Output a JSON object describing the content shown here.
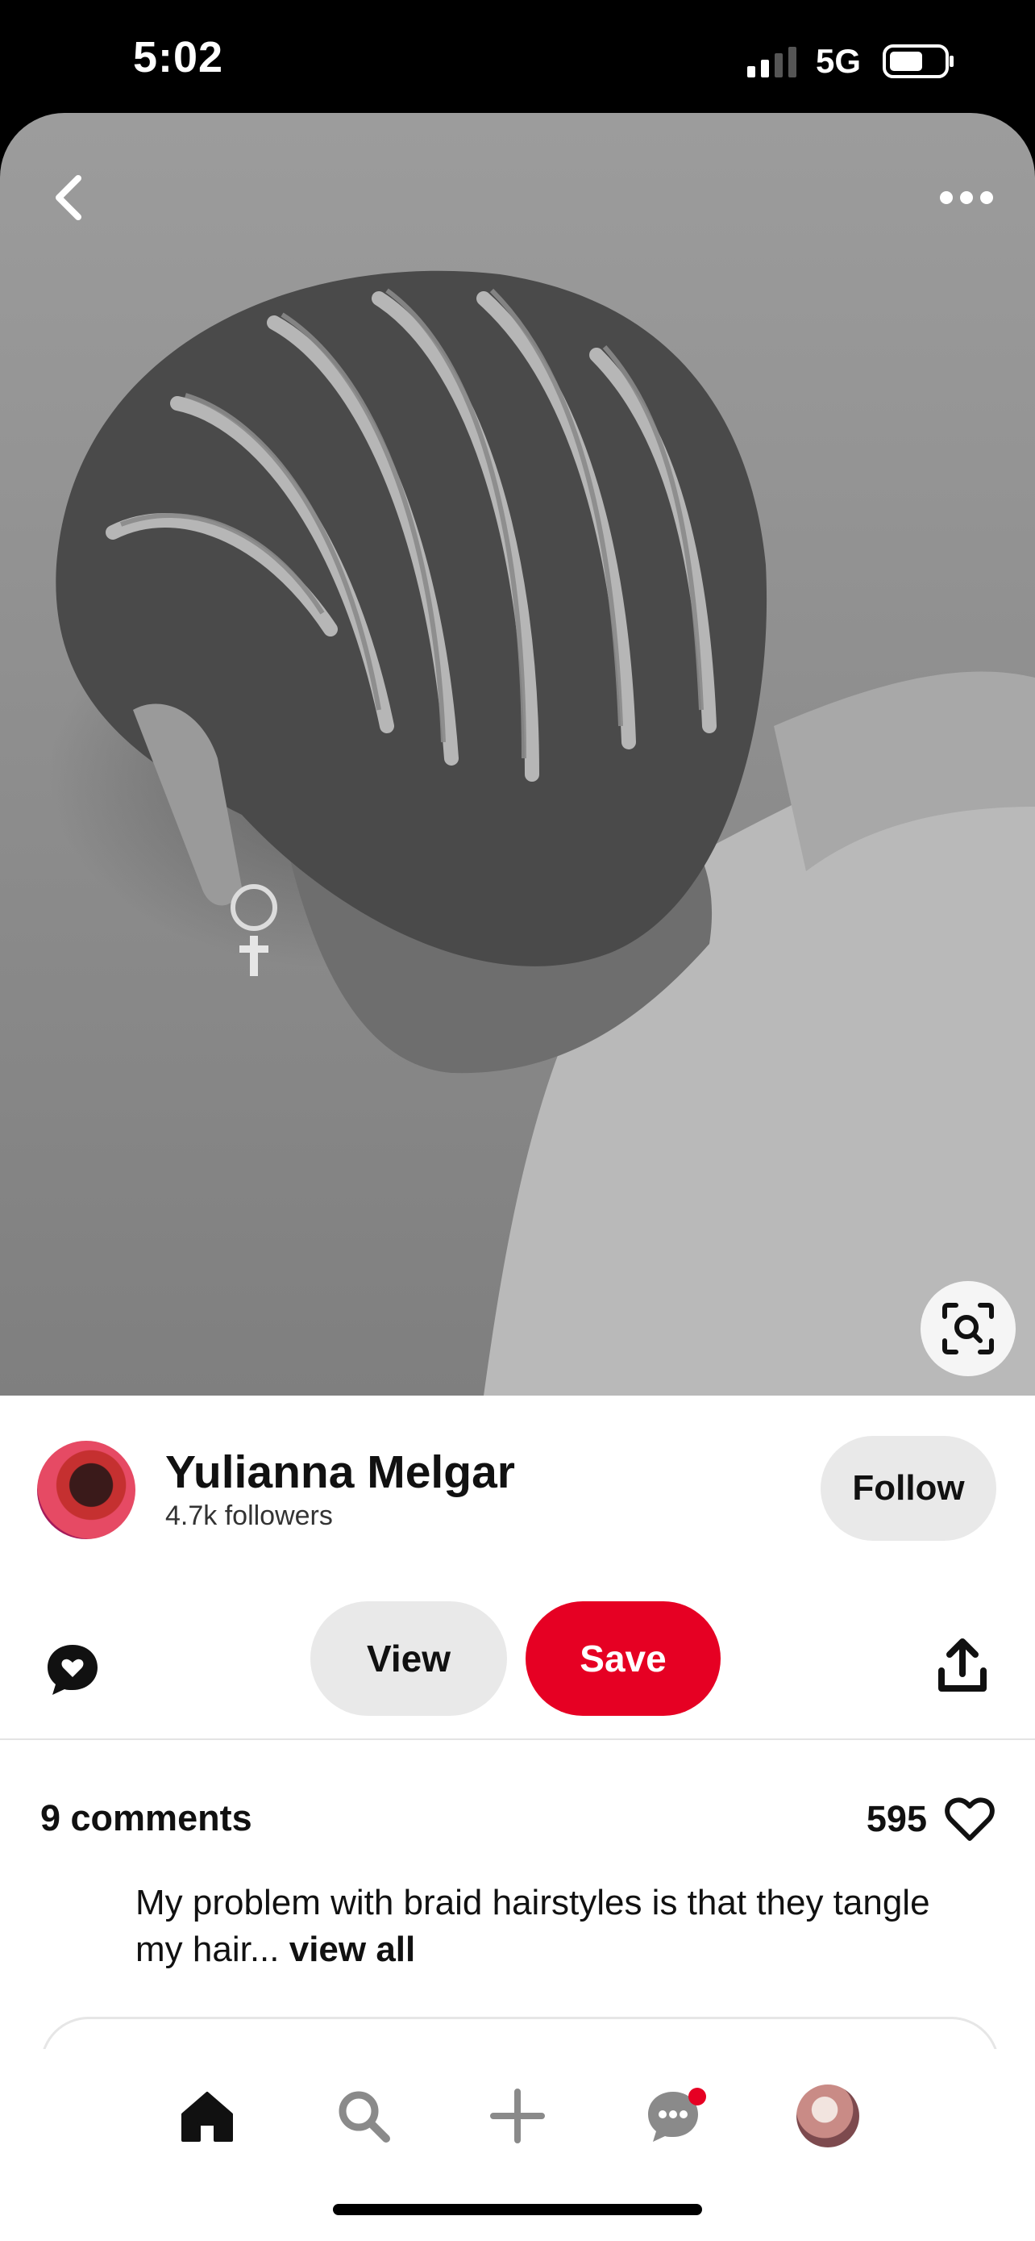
{
  "status_bar": {
    "time": "5:02",
    "network": "5G"
  },
  "pin": {
    "image_alt": "Black and white photo of person with short braided hair and cross earring",
    "icons": {
      "back": "chevron-left-icon",
      "more": "more-dots-icon",
      "visual_search": "visual-search-icon"
    }
  },
  "creator": {
    "name": "Yulianna Melgar",
    "followers": "4.7k followers",
    "follow_label": "Follow"
  },
  "actions": {
    "view_label": "View",
    "save_label": "Save",
    "comment_icon": "comment-heart-icon",
    "share_icon": "share-icon"
  },
  "comments": {
    "count_label": "9 comments",
    "likes": "595",
    "preview_text": "My problem with braid hairstyles is that they tangle my hair... ",
    "view_all_label": "view all"
  },
  "bottom_nav": {
    "items": [
      "home-icon",
      "search-icon",
      "plus-icon",
      "messages-icon",
      "profile-avatar"
    ],
    "active": "home"
  },
  "colors": {
    "accent": "#e60023",
    "button_gray": "#e9e9e9",
    "text": "#111111"
  }
}
